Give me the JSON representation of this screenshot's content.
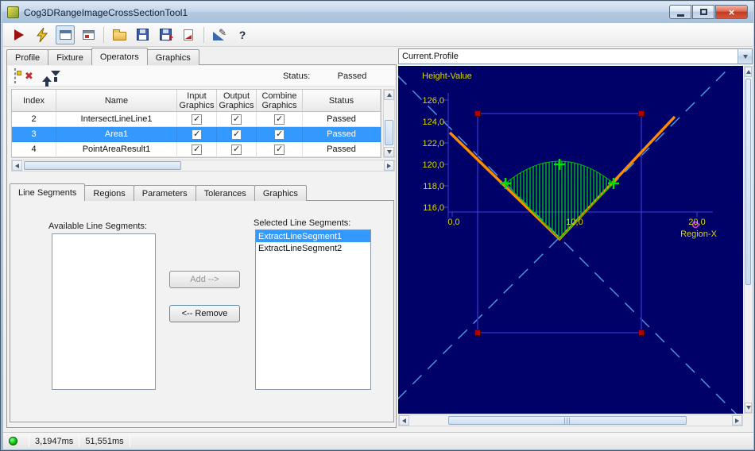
{
  "window": {
    "title": "Cog3DRangeImageCrossSectionTool1"
  },
  "toolbar": {
    "icons": [
      "run-icon",
      "run-loop-lightning-icon",
      "tool-display-toggle-icon",
      "result-display-icon",
      "open-folder-icon",
      "save-icon",
      "save-results-icon",
      "import-icon",
      "edit-tool-icon",
      "help-icon"
    ]
  },
  "main_tabs": [
    {
      "label": "Profile",
      "active": false
    },
    {
      "label": "Fixture",
      "active": false
    },
    {
      "label": "Operators",
      "active": true
    },
    {
      "label": "Graphics",
      "active": false
    }
  ],
  "operators": {
    "toolbar_icons": [
      "new-operator-icon",
      "delete-operator-icon",
      "move-up-icon",
      "move-down-icon"
    ],
    "status_label": "Status:",
    "status_value": "Passed",
    "grid": {
      "columns": [
        "Index",
        "Name",
        "Input Graphics",
        "Output Graphics",
        "Combine Graphics",
        "Status"
      ],
      "rows": [
        {
          "index": "2",
          "name": "IntersectLineLine1",
          "input": true,
          "output": true,
          "combine": true,
          "status": "Passed",
          "selected": false
        },
        {
          "index": "3",
          "name": "Area1",
          "input": true,
          "output": true,
          "combine": true,
          "status": "Passed",
          "selected": true
        },
        {
          "index": "4",
          "name": "PointAreaResult1",
          "input": true,
          "output": true,
          "combine": true,
          "status": "Passed",
          "selected": false
        }
      ]
    },
    "sub_tabs": [
      {
        "label": "Line Segments",
        "active": true
      },
      {
        "label": "Regions",
        "active": false
      },
      {
        "label": "Parameters",
        "active": false
      },
      {
        "label": "Tolerances",
        "active": false
      },
      {
        "label": "Graphics",
        "active": false
      }
    ],
    "line_segments": {
      "available_label": "Available Line Segments:",
      "selected_label": "Selected Line Segments:",
      "add_button": "Add -->",
      "remove_button": "<-- Remove",
      "available_items": [],
      "selected_items": [
        {
          "label": "ExtractLineSegment1",
          "selected": true
        },
        {
          "label": "ExtractLineSegment2",
          "selected": false
        }
      ]
    }
  },
  "display": {
    "record_selector": "Current.Profile",
    "graph": {
      "y_axis_label": "Height-Value",
      "x_axis_label": "Region-X",
      "y_ticks": [
        "126,0",
        "124,0",
        "122,0",
        "120,0",
        "118,0",
        "116,0"
      ],
      "x_ticks": [
        "0,0",
        "10,0",
        "20,0"
      ]
    }
  },
  "status_bar": {
    "process_time": "3,1947ms",
    "total_time": "51,551ms"
  },
  "colors": {
    "selection": "#3399ff",
    "graph_background": "#000069",
    "axis_label": "#d9d900",
    "profile_line": "#ff8c00",
    "area_result": "#00cc00",
    "crosshair": "#4aa0e8",
    "status_passed": "#1a1a1a"
  }
}
